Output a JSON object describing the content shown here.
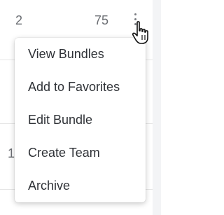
{
  "table": {
    "rows": [
      {
        "count": "2",
        "value": "75"
      },
      {
        "count": "1"
      }
    ]
  },
  "row_menu": {
    "trigger_icon": "kebab-vertical-icon",
    "cursor_icon": "hand-pointer-icon",
    "items": [
      {
        "label": "View Bundles"
      },
      {
        "label": "Add to Favorites"
      },
      {
        "label": "Edit Bundle"
      },
      {
        "label": "Create Team"
      },
      {
        "label": "Archive"
      }
    ]
  }
}
